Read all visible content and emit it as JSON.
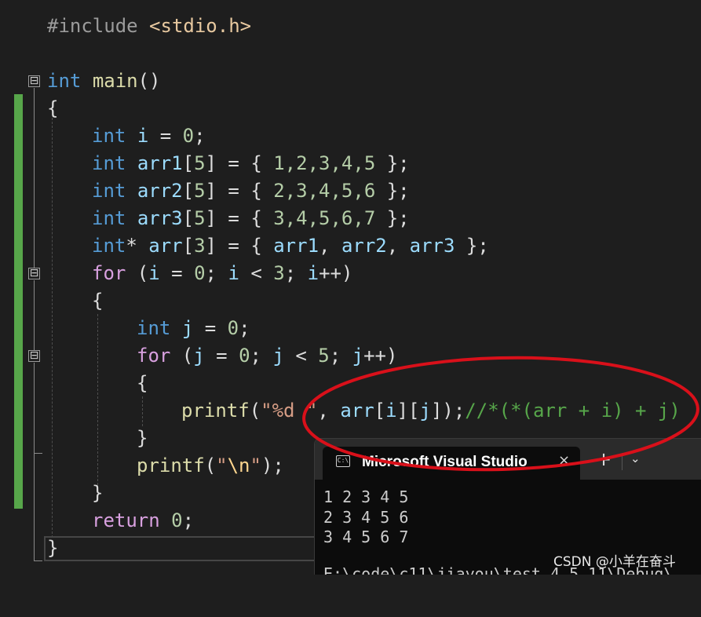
{
  "editor": {
    "line_include": {
      "directive": "#include",
      "header": "<stdio.h>"
    },
    "line_main": {
      "type": "int",
      "name": "main",
      "parens": "()"
    },
    "brace_open": "{",
    "brace_close": "}",
    "line_i": {
      "type": "int",
      "name": "i",
      "rest1": " = ",
      "value": "0",
      "rest2": ";"
    },
    "line_arr1": {
      "type": "int",
      "name": "arr1",
      "lb": "[",
      "size": "5",
      "rb": "]",
      "eq": " = { ",
      "vals": "1,2,3,4,5",
      "end": " };"
    },
    "line_arr2": {
      "type": "int",
      "name": "arr2",
      "lb": "[",
      "size": "5",
      "rb": "]",
      "eq": " = { ",
      "vals": "2,3,4,5,6",
      "end": " };"
    },
    "line_arr3": {
      "type": "int",
      "name": "arr3",
      "lb": "[",
      "size": "5",
      "rb": "]",
      "eq": " = { ",
      "vals": "3,4,5,6,7",
      "end": " };"
    },
    "line_arr": {
      "type": "int",
      "star": "*",
      "name": "arr",
      "lb": "[",
      "size": "3",
      "rb": "]",
      "eq": " = { ",
      "a1": "arr1",
      "comma1": ", ",
      "a2": "arr2",
      "comma2": ", ",
      "a3": "arr3",
      "end": " };"
    },
    "line_for1": {
      "kw": "for",
      "p1": " (",
      "v1": "i",
      "p2": " = ",
      "n1": "0",
      "p3": "; ",
      "v2": "i",
      "p4": " < ",
      "n2": "3",
      "p5": "; ",
      "v3": "i",
      "p6": "++)"
    },
    "line_j": {
      "type": "int",
      "name": "j",
      "rest1": " = ",
      "value": "0",
      "rest2": ";"
    },
    "line_for2": {
      "kw": "for",
      "p1": " (",
      "v1": "j",
      "p2": " = ",
      "n1": "0",
      "p3": "; ",
      "v2": "j",
      "p4": " < ",
      "n2": "5",
      "p5": "; ",
      "v3": "j",
      "p6": "++)"
    },
    "line_printf1": {
      "fn": "printf",
      "p1": "(",
      "str": "\"%d \"",
      "p2": ", ",
      "arr": "arr",
      "lb1": "[",
      "i": "i",
      "rb1": "][",
      "j": "j",
      "rb2": "]);",
      "comment": "//*(*(arr + i) + j)"
    },
    "line_printf2": {
      "fn": "printf",
      "p1": "(",
      "q1": "\"",
      "esc": "\\n",
      "q2": "\"",
      "p2": ");"
    },
    "line_return": {
      "kw": "return",
      "sp": " ",
      "value": "0",
      "end": ";"
    },
    "fold_minus": "⊟"
  },
  "terminal": {
    "tab_icon": "C:\\",
    "tab_title": "Microsoft Visual Studio",
    "tab_close": "×",
    "new_tab": "+",
    "dropdown": "⌄",
    "output": [
      "1 2 3 4 5",
      "2 3 4 5 6",
      "3 4 5 6 7"
    ],
    "output_cut": "E:\\code\\c11\\jiayou\\test_4_5_11\\Debug\\"
  },
  "watermark": "CSDN @小羊在奋斗",
  "colors": {
    "background": "#1e1e1e",
    "keyword": "#569cd6",
    "control": "#d8a0df",
    "function": "#dcdcaa",
    "number": "#b5cea8",
    "variable": "#9cdcfe",
    "string": "#d69d85",
    "comment": "#57a64a",
    "annotation": "#d9101a"
  }
}
